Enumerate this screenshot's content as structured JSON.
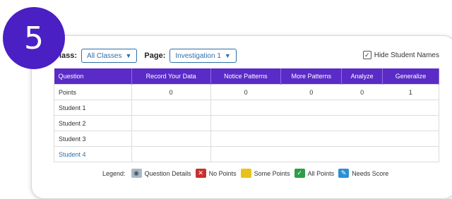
{
  "step_number": "5",
  "filters": {
    "class_label": "Class:",
    "class_value": "All Classes",
    "page_label": "Page:",
    "page_value": "Investigation 1"
  },
  "hide_student_names": {
    "label": "Hide Student Names",
    "checked": true
  },
  "table": {
    "headers": [
      "Question",
      "Record Your Data",
      "Notice Patterns",
      "More Patterns",
      "Analyze",
      "Generalize"
    ],
    "points_row": {
      "label": "Points",
      "values": [
        "0",
        "0",
        "0",
        "0",
        "1"
      ]
    },
    "students": [
      "Student 1",
      "Student 2",
      "Student 3",
      "Student 4"
    ]
  },
  "legend": {
    "title": "Legend:",
    "items": [
      {
        "label": "Question Details",
        "icon": "eye-icon",
        "color": "#a9b8c8"
      },
      {
        "label": "No Points",
        "icon": "x-icon",
        "color": "#c9302c"
      },
      {
        "label": "Some Points",
        "icon": "",
        "color": "#e8c21b"
      },
      {
        "label": "All Points",
        "icon": "check-icon",
        "color": "#2f9c48"
      },
      {
        "label": "Needs Score",
        "icon": "pencil-icon",
        "color": "#2b8fd6"
      }
    ]
  },
  "colors": {
    "badge": "#4a1fc4",
    "header": "#5a2bc7",
    "link": "#2f6fa7"
  }
}
